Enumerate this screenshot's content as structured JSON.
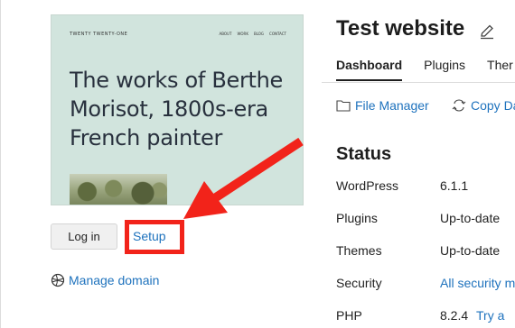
{
  "preview": {
    "site_name": "TWENTY TWENTY-ONE",
    "nav": [
      "ABOUT",
      "WORK",
      "BLOG",
      "CONTACT"
    ],
    "heading": "The works of Berthe Morisot, 1800s-era French painter"
  },
  "actions": {
    "login_label": "Log in",
    "setup_label": "Setup",
    "manage_domain_label": "Manage domain"
  },
  "site": {
    "title": "Test website"
  },
  "tabs": [
    {
      "label": "Dashboard",
      "active": true
    },
    {
      "label": "Plugins",
      "active": false
    },
    {
      "label": "Ther",
      "active": false
    }
  ],
  "tools": {
    "file_manager": "File Manager",
    "copy_data": "Copy Da"
  },
  "status": {
    "heading": "Status",
    "rows": [
      {
        "label": "WordPress",
        "value": "6.1.1"
      },
      {
        "label": "Plugins",
        "value": "Up-to-date"
      },
      {
        "label": "Themes",
        "value": "Up-to-date"
      },
      {
        "label": "Security",
        "value": "All security m"
      },
      {
        "label": "PHP",
        "value": "8.2.4",
        "extra": "Try a"
      }
    ]
  },
  "colors": {
    "link": "#1e72bd",
    "highlight": "#f2231a",
    "preview_bg": "#d1e4dd"
  }
}
